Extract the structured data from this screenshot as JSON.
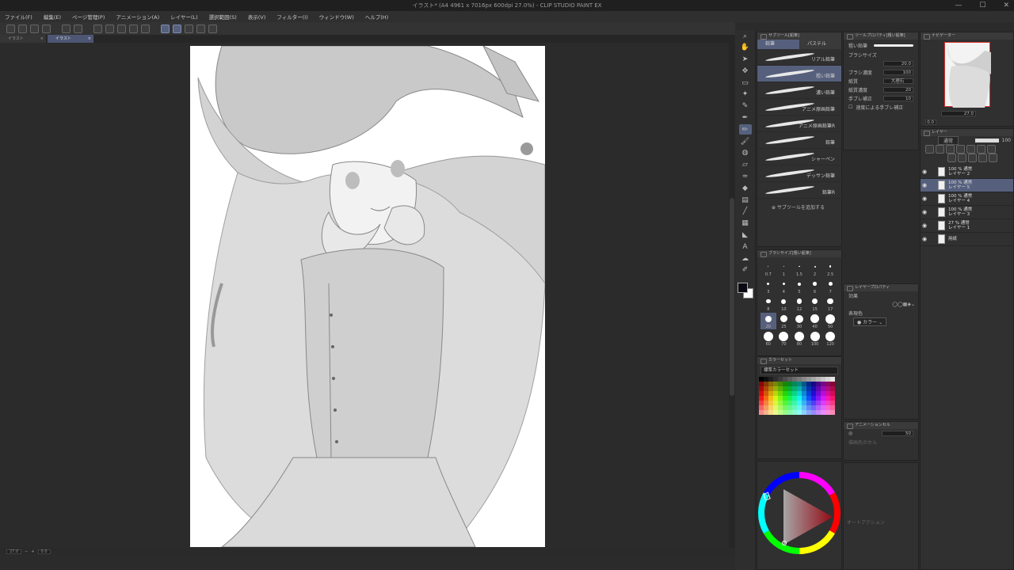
{
  "window": {
    "title": "イラスト* (A4 4961 x 7016px 600dpi 27.0%) - CLIP STUDIO PAINT EX",
    "controls": {
      "minimize": "—",
      "maximize": "☐",
      "close": "✕"
    }
  },
  "menu": [
    "ファイル(F)",
    "編集(E)",
    "ページ管理(P)",
    "アニメーション(A)",
    "レイヤー(L)",
    "選択範囲(S)",
    "表示(V)",
    "フィルター(I)",
    "ウィンドウ(W)",
    "ヘルプ(H)"
  ],
  "doc_tabs": [
    {
      "label": "イラスト",
      "close": "×"
    },
    {
      "label": "イラスト",
      "close": "×"
    }
  ],
  "status": {
    "zoom": "27.0",
    "angle": "0.0"
  },
  "subtool_panel": {
    "title": "サブツール[鉛筆]",
    "tabs": [
      "鉛筆",
      "パステル"
    ],
    "items": [
      "リアル鉛筆",
      "粗い鉛筆",
      "濃い鉛筆",
      "アニメ原画鉛筆",
      "アニメ原画鉛筆R",
      "鉛筆",
      "シャーペン",
      "デッサン鉛筆",
      "鉛筆R"
    ],
    "selected_index": 1,
    "add_label": "サブツールを追加する"
  },
  "tool_property": {
    "title": "ツールプロパティ[粗い鉛筆]",
    "brush_name": "粗い鉛筆",
    "brush_size_label": "ブラシサイズ",
    "brush_size": "20.0",
    "brush_density_label": "ブラシ濃度",
    "brush_density": "100",
    "paper_label": "紙質",
    "paper_value": "大理石",
    "paper_density_label": "紙質濃度",
    "paper_density": "20",
    "stabilization_label": "手ブレ補正",
    "stabilization": "10",
    "speed_label": "速度による手ブレ補正"
  },
  "brush_size_panel": {
    "title": "ブラシサイズ[粗い鉛筆]",
    "sizes": [
      "0.7",
      "1",
      "1.5",
      "2",
      "2.5",
      "3",
      "4",
      "5",
      "6",
      "7",
      "8",
      "10",
      "12",
      "15",
      "17",
      "20",
      "25",
      "30",
      "40",
      "50",
      "60",
      "70",
      "80",
      "100",
      "120"
    ]
  },
  "color_set": {
    "title": "カラーセット",
    "set_name": "標準カラーセット"
  },
  "layer_property": {
    "title": "レイヤープロパティ",
    "effect_label": "効果",
    "express_label": "表現色",
    "express_value": "カラー"
  },
  "animation_panel": {
    "title": "アニメーションセル",
    "opacity": "50",
    "placeholder": "描画先のセル"
  },
  "autoaction_placeholder": "オートアクション",
  "navigator": {
    "title": "ナビゲーター",
    "zoom": "27.0",
    "angle": "0.0"
  },
  "layer_panel": {
    "title": "レイヤー",
    "blend": "通常",
    "opacity": "100",
    "layers": [
      {
        "line1": "100 % 通常",
        "line2": "レイヤー 2"
      },
      {
        "line1": "100 % 通常",
        "line2": "レイヤー 5"
      },
      {
        "line1": "100 % 通常",
        "line2": "レイヤー 4"
      },
      {
        "line1": "100 % 通常",
        "line2": "レイヤー 3"
      },
      {
        "line1": "27 % 通常",
        "line2": "レイヤー 1"
      },
      {
        "line1": "",
        "line2": "用紙"
      }
    ],
    "selected_index": 1
  },
  "colors": {
    "accent": "#56607d",
    "panel": "#303030",
    "canvas_bg": "#2b2b2b",
    "main_color": "#0a0a12",
    "sub_color": "#ffffff"
  }
}
